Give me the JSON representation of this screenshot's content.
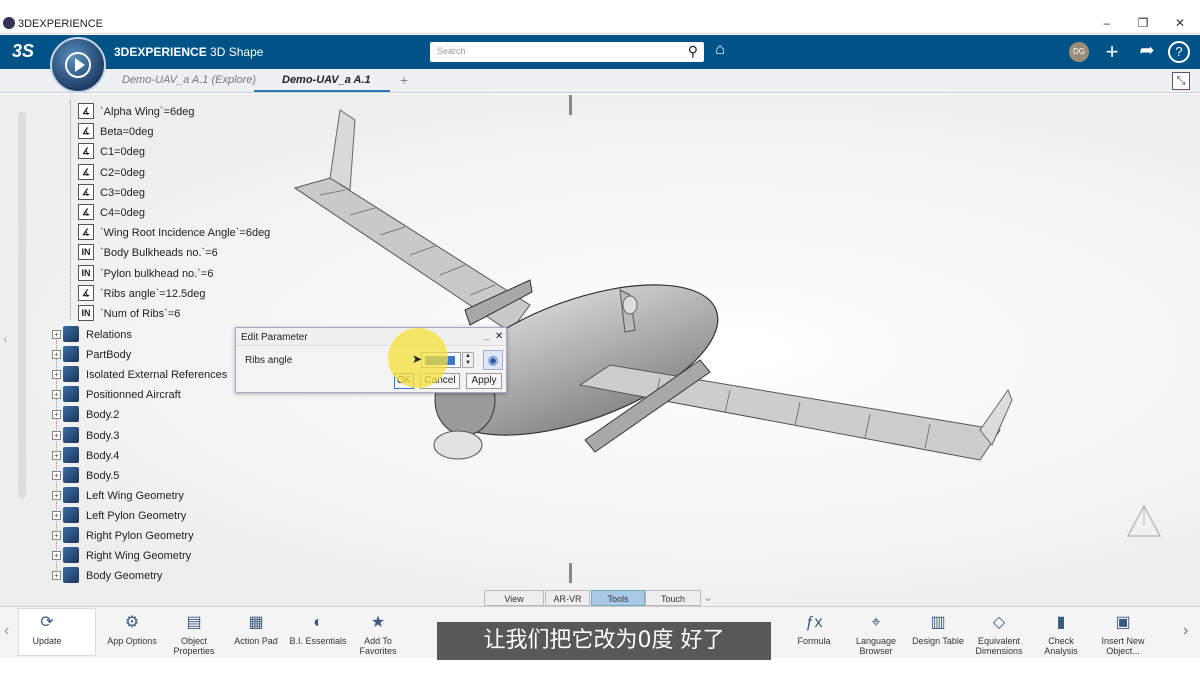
{
  "window": {
    "title": "3DEXPERIENCE"
  },
  "header": {
    "brand": "3DEXPERIENCE",
    "app": "3D Shape",
    "search_placeholder": "Search",
    "user_initials": "DG"
  },
  "tabs": [
    {
      "label": "Demo-UAV_a A.1 (Explore)"
    },
    {
      "label": "Demo-UAV_a A.1"
    }
  ],
  "parameters": [
    {
      "label": "`Alpha Wing`=6deg",
      "type": "angle"
    },
    {
      "label": "Beta=0deg",
      "type": "angle"
    },
    {
      "label": "C1=0deg",
      "type": "angle"
    },
    {
      "label": "C2=0deg",
      "type": "angle"
    },
    {
      "label": "C3=0deg",
      "type": "angle"
    },
    {
      "label": "C4=0deg",
      "type": "angle"
    },
    {
      "label": "`Wing Root Incidence Angle`=6deg",
      "type": "angle"
    },
    {
      "label": "`Body Bulkheads no.`=6",
      "type": "integer"
    },
    {
      "label": "`Pylon bulkhead no.`=6",
      "type": "integer"
    },
    {
      "label": "`Ribs angle`=12.5deg",
      "type": "angle"
    },
    {
      "label": "`Num of Ribs`=6",
      "type": "integer"
    }
  ],
  "tree_nodes": [
    {
      "label": "Relations"
    },
    {
      "label": "PartBody"
    },
    {
      "label": "Isolated External References"
    },
    {
      "label": "Positionned Aircraft"
    },
    {
      "label": "Body.2"
    },
    {
      "label": "Body.3"
    },
    {
      "label": "Body.4"
    },
    {
      "label": "Body.5"
    },
    {
      "label": "Left Wing Geometry"
    },
    {
      "label": "Left Pylon Geometry"
    },
    {
      "label": "Right Pylon Geometry"
    },
    {
      "label": "Right Wing Geometry"
    },
    {
      "label": "Body Geometry"
    }
  ],
  "dialog": {
    "title": "Edit Parameter",
    "param_label": "Ribs angle",
    "ok": "OK",
    "cancel": "Cancel",
    "apply": "Apply"
  },
  "view_tabs": [
    {
      "label": "View"
    },
    {
      "label": "AR-VR"
    },
    {
      "label": "Tools"
    },
    {
      "label": "Touch"
    }
  ],
  "toolbar": [
    {
      "label": "Update",
      "icon": "update-icon"
    },
    {
      "label": "App Options",
      "icon": "app-options-icon"
    },
    {
      "label": "Object Properties",
      "icon": "object-properties-icon"
    },
    {
      "label": "Action Pad",
      "icon": "action-pad-icon"
    },
    {
      "label": "B.I. Essentials",
      "icon": "bi-essentials-icon"
    },
    {
      "label": "Add To Favorites",
      "icon": "star-icon"
    },
    {
      "label": "Formula",
      "icon": "formula-icon"
    },
    {
      "label": "Language Browser",
      "icon": "language-browser-icon"
    },
    {
      "label": "Design Table",
      "icon": "design-table-icon"
    },
    {
      "label": "Equivalent Dimensions",
      "icon": "equivalent-dimensions-icon"
    },
    {
      "label": "Check Analysis",
      "icon": "check-analysis-icon"
    },
    {
      "label": "Insert New Object...",
      "icon": "insert-new-object-icon"
    }
  ],
  "subtitle": "让我们把它改为0度 好了",
  "colors": {
    "header": "#005386",
    "accent": "#2a7ab8",
    "highlight": "#f7e23a"
  }
}
